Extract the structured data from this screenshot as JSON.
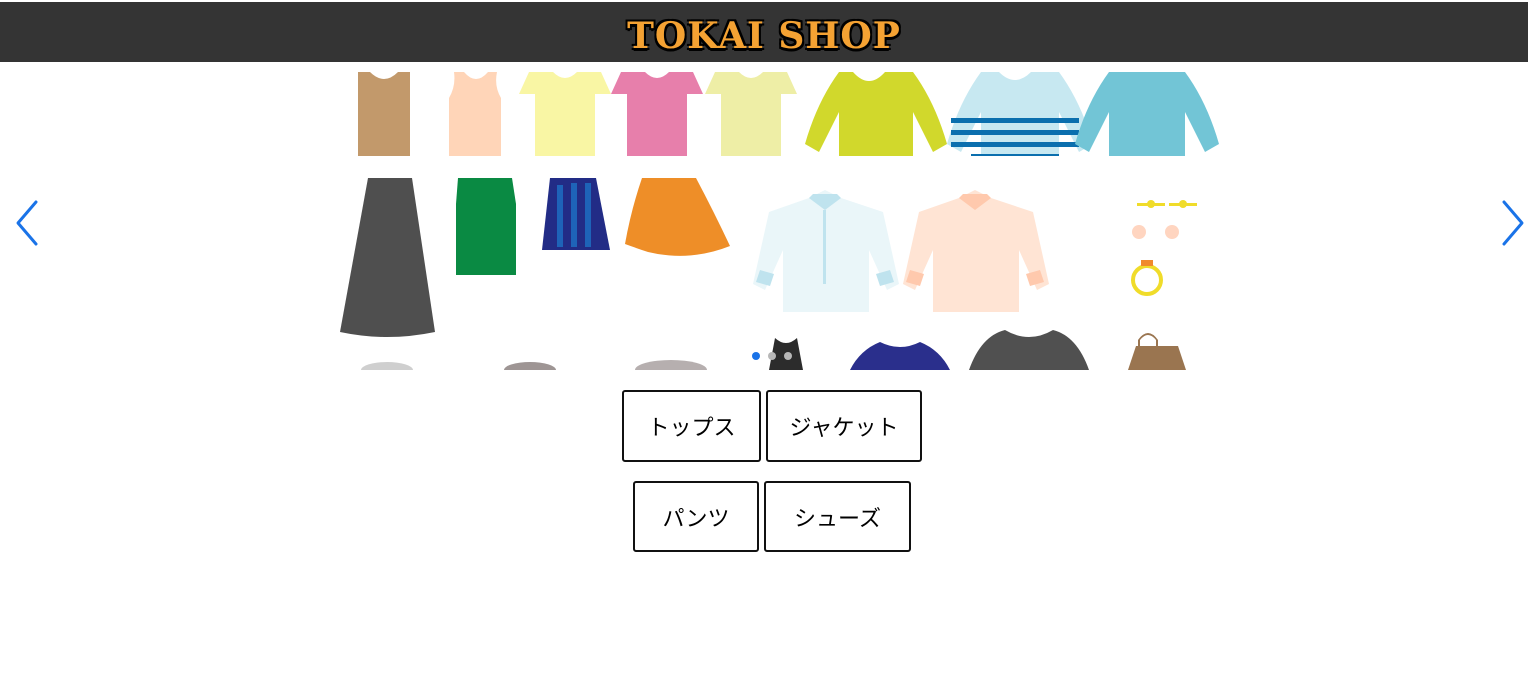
{
  "header": {
    "logo_text": "TOKAI SHOP"
  },
  "carousel": {
    "prev_icon": "chevron-left-icon",
    "next_icon": "chevron-right-icon",
    "dot_count": 3,
    "active_index": 0,
    "accent_color": "#1a73e8"
  },
  "categories": {
    "row1": [
      {
        "label": "トップス"
      },
      {
        "label": "ジャケット"
      }
    ],
    "row2": [
      {
        "label": "パンツ"
      },
      {
        "label": "シューズ"
      }
    ]
  },
  "colors": {
    "header_bg": "#343434",
    "logo": "#f4a233"
  }
}
